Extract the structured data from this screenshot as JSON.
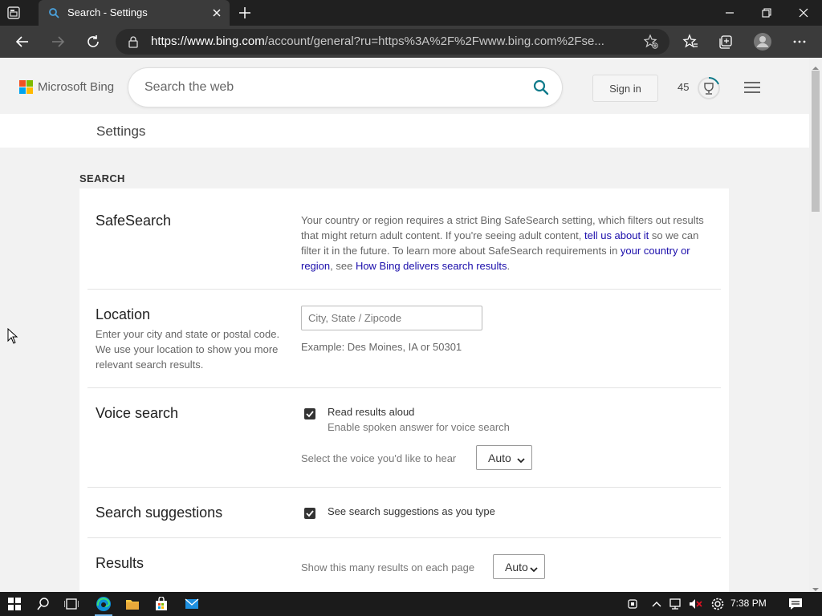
{
  "browser": {
    "tab_title": "Search - Settings",
    "url_prefix": "https://",
    "url_domain": "www.bing.com",
    "url_rest": "/account/general?ru=https%3A%2F%2Fwww.bing.com%2Fse..."
  },
  "header": {
    "logo_text": "Microsoft Bing",
    "search_placeholder": "Search the web",
    "sign_in_label": "Sign in",
    "points": "45"
  },
  "settings": {
    "title": "Settings",
    "section_title": "SEARCH",
    "safesearch": {
      "title": "SafeSearch",
      "text1": "Your country or region requires a strict Bing SafeSearch setting, which filters out results that might return adult content. If you're seeing adult content, ",
      "link1": "tell us about it",
      "text2": " so we can filter it in the future. To learn more about SafeSearch requirements in ",
      "link2": "your country or region",
      "text3": ", see ",
      "link3": "How Bing delivers search results",
      "text4": "."
    },
    "location": {
      "title": "Location",
      "description": "Enter your city and state or postal code. We use your location to show you more relevant search results.",
      "placeholder": "City, State / Zipcode",
      "example": "Example: Des Moines, IA or 50301"
    },
    "voice": {
      "title": "Voice search",
      "checkbox_label": "Read results aloud",
      "checkbox_sub": "Enable spoken answer for voice search",
      "select_label": "Select the voice you'd like to hear",
      "select_value": "Auto"
    },
    "suggestions": {
      "title": "Search suggestions",
      "checkbox_label": "See search suggestions as you type"
    },
    "results": {
      "title": "Results",
      "select_label": "Show this many results on each page",
      "select_value": "Auto"
    }
  },
  "taskbar": {
    "time": "7:38 PM"
  },
  "colors": {
    "link": "#1a0dab",
    "bing_teal": "#0e7a8a",
    "tab_active": "#3b3b3b",
    "chrome_dark": "#202020"
  }
}
